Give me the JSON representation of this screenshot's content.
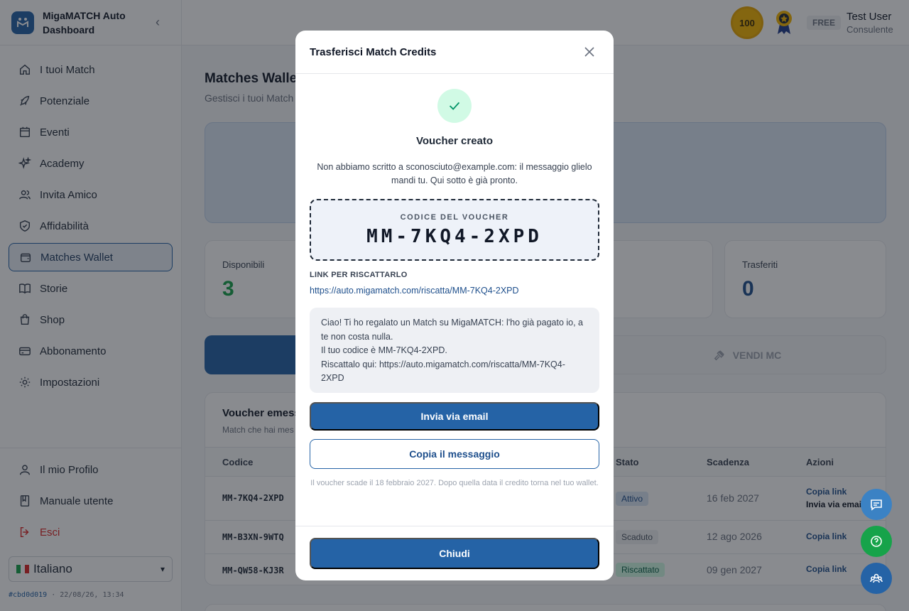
{
  "app": {
    "title": "MigaMATCH Auto Dashboard"
  },
  "sidebar": {
    "items": [
      {
        "label": "I tuoi Match",
        "icon": "home-icon"
      },
      {
        "label": "Potenziale",
        "icon": "rocket-icon"
      },
      {
        "label": "Eventi",
        "icon": "calendar-icon"
      },
      {
        "label": "Academy",
        "icon": "sparkles-icon"
      },
      {
        "label": "Invita Amico",
        "icon": "users-icon"
      },
      {
        "label": "Affidabilità",
        "icon": "shield-icon"
      },
      {
        "label": "Matches Wallet",
        "icon": "wallet-icon",
        "active": true
      },
      {
        "label": "Storie",
        "icon": "book-icon"
      },
      {
        "label": "Shop",
        "icon": "shopping-bag-icon"
      },
      {
        "label": "Abbonamento",
        "icon": "credit-card-icon"
      },
      {
        "label": "Impostazioni",
        "icon": "gear-icon"
      }
    ],
    "bottom": [
      {
        "label": "Il mio Profilo",
        "icon": "user-icon"
      },
      {
        "label": "Manuale utente",
        "icon": "manual-icon"
      },
      {
        "label": "Esci",
        "icon": "logout-icon"
      }
    ],
    "language": "Italiano",
    "build_hash": "#cbd0d019",
    "build_time": " · 22/08/26, 13:34"
  },
  "header": {
    "badge_level": "100",
    "plan": "FREE",
    "user_name": "Test User",
    "user_role": "Consulente"
  },
  "page": {
    "title": "Matches Wallet",
    "subtitle": "Gestisci i tuoi Match",
    "stats": [
      {
        "label": "Disponibili",
        "value": "3",
        "color": "#16a34a"
      },
      {
        "label": "Trasferiti",
        "value": "0",
        "color": "#1e4f8c"
      }
    ],
    "sell_label": "VENDI MC",
    "vouchers": {
      "title": "Voucher emessi",
      "subtitle": "Match che hai mes",
      "headers": {
        "code": "Codice",
        "status": "Stato",
        "expiry": "Scadenza",
        "actions": "Azioni"
      },
      "rows": [
        {
          "code": "MM-7KQ4-2XPD",
          "status": "Attivo",
          "expiry": "16 feb 2027",
          "action1": "Copia link",
          "action2": "Invia via email"
        },
        {
          "code": "MM-B3XN-9WTQ",
          "status": "Scaduto",
          "expiry": "12 ago 2026",
          "action1": "Copia link"
        },
        {
          "code": "MM-QW58-KJ3R",
          "status": "Riscattato",
          "expiry": "09 gen 2027",
          "action1": "Copia link"
        }
      ]
    }
  },
  "modal": {
    "title": "Trasferisci Match Credits",
    "heading": "Voucher creato",
    "description": "Non abbiamo scritto a sconosciuto@example.com: il messaggio glielo mandi tu. Qui sotto è già pronto.",
    "voucher_label": "CODICE DEL VOUCHER",
    "voucher_code": "MM-7KQ4-2XPD",
    "link_label": "LINK PER RISCATTARLO",
    "link_url": "https://auto.migamatch.com/riscatta/MM-7KQ4-2XPD",
    "message_lines": [
      "Ciao! Ti ho regalato un Match su MigaMATCH: l'ho già pagato io, a te non costa nulla.",
      "Il tuo codice è MM-7KQ4-2XPD.",
      "Riscattalo qui: https://auto.migamatch.com/riscatta/MM-7KQ4-2XPD"
    ],
    "email_button": "Invia via email",
    "copy_button": "Copia il messaggio",
    "expiry_note": "Il voucher scade il 18 febbraio 2027. Dopo quella data il credito torna nel tuo wallet.",
    "close_button": "Chiudi"
  },
  "colors": {
    "accent": "#2563a6",
    "success": "#059669",
    "danger": "#dc2626"
  }
}
